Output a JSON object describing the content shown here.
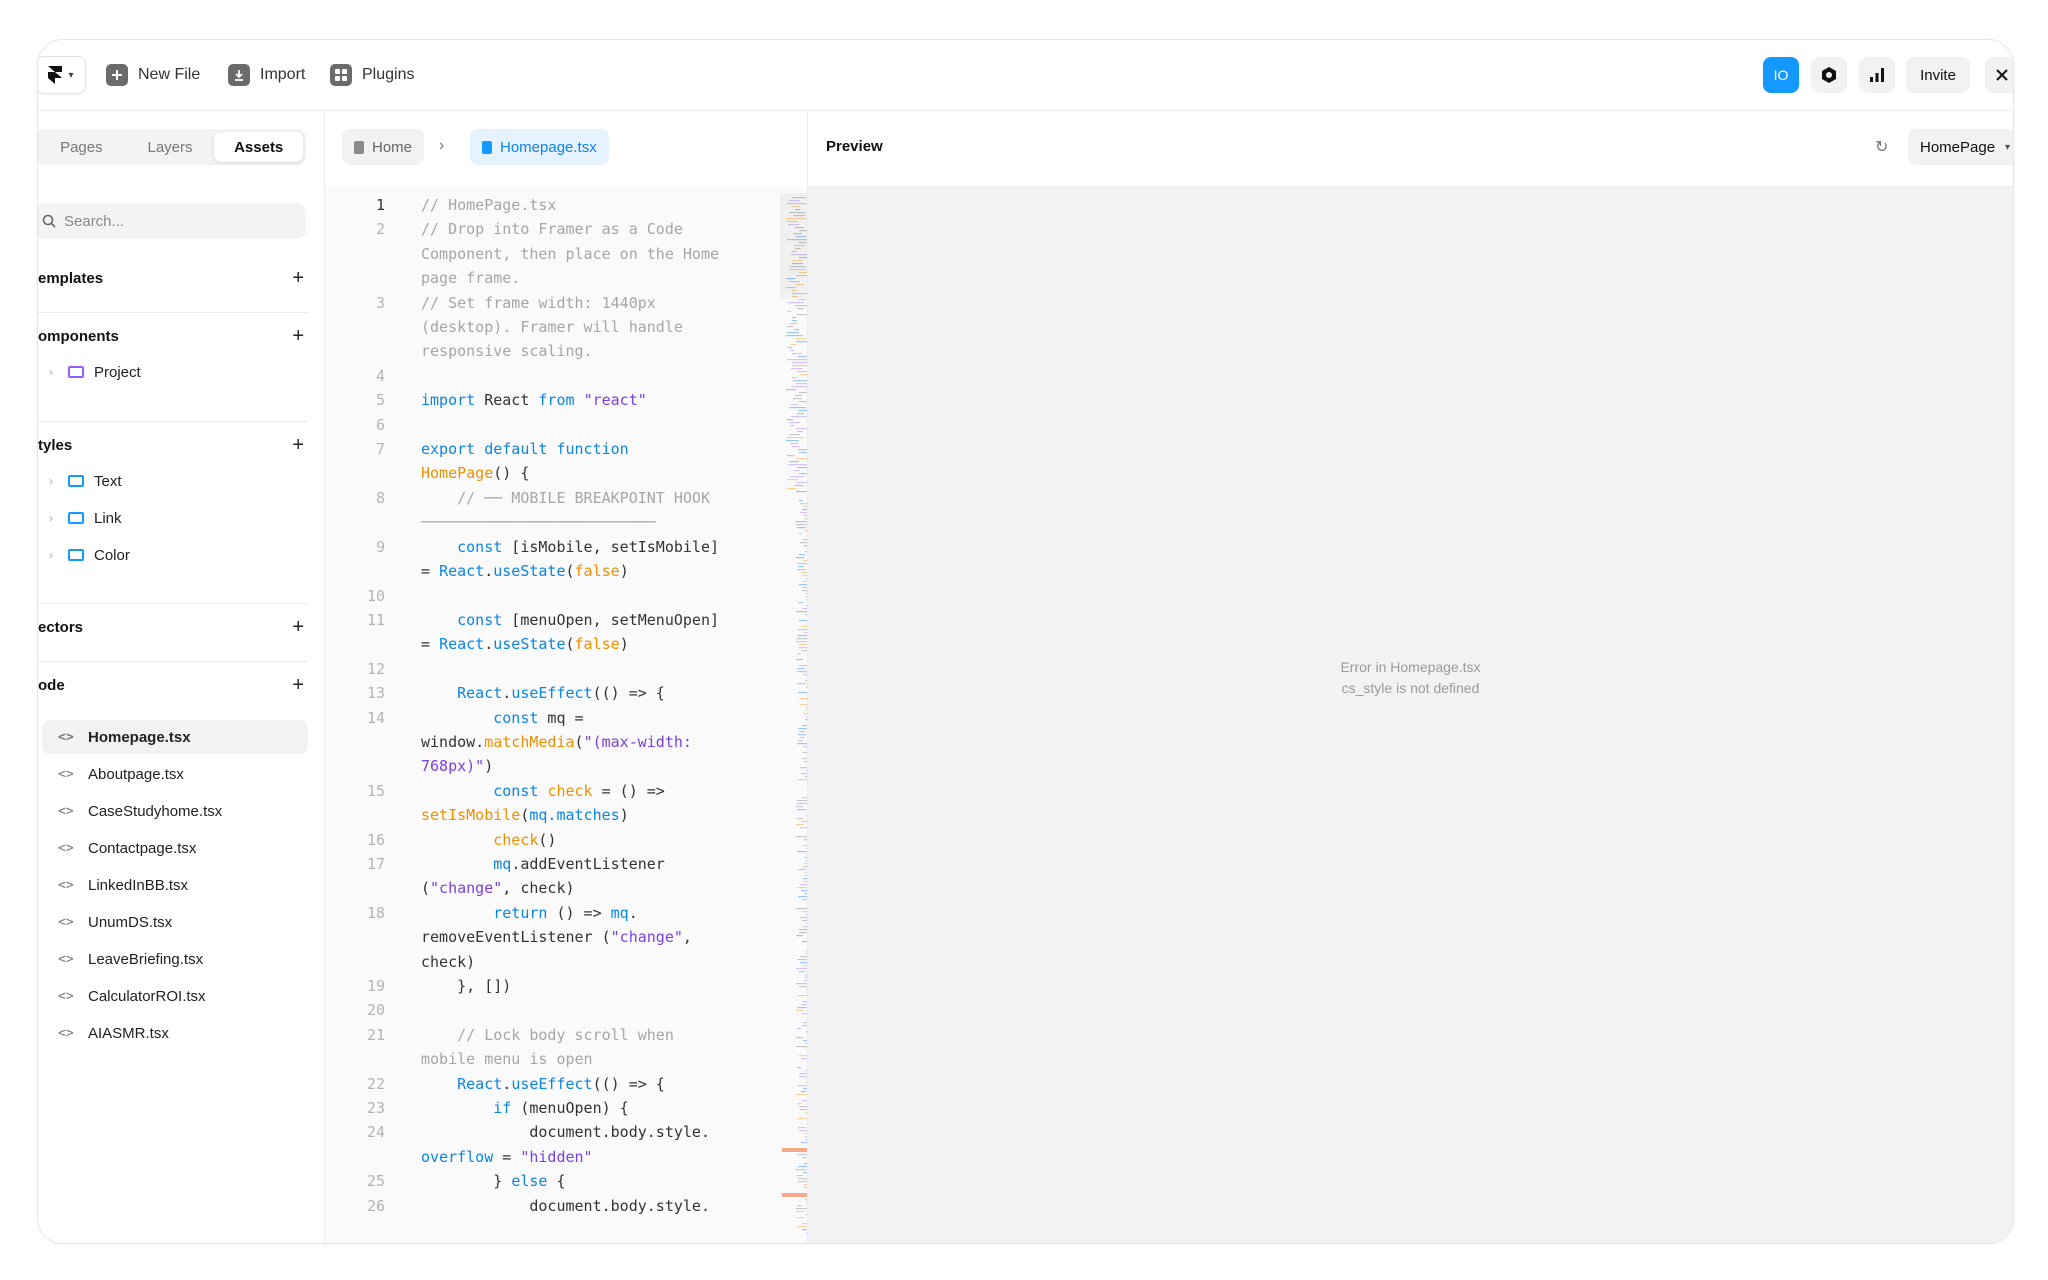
{
  "toolbar": {
    "new_file": "New File",
    "import": "Import",
    "plugins": "Plugins",
    "io_badge": "IO",
    "invite": "Invite"
  },
  "sidebar": {
    "tabs": [
      "Pages",
      "Layers",
      "Assets"
    ],
    "active_tab": "Assets",
    "search_placeholder": "Search...",
    "sections": {
      "templates": "emplates",
      "components": "omponents",
      "styles": "tyles",
      "vectors": "ectors",
      "code": "ode"
    },
    "component_items": [
      "Project"
    ],
    "style_items": [
      "Text",
      "Link",
      "Color"
    ],
    "code_files": [
      "Homepage.tsx",
      "Aboutpage.tsx",
      "CaseStudyhome.tsx",
      "Contactpage.tsx",
      "LinkedInBB.tsx",
      "UnumDS.tsx",
      "LeaveBriefing.tsx",
      "CalculatorROI.tsx",
      "AIASMR.tsx"
    ],
    "selected_file": "Homepage.tsx"
  },
  "editor": {
    "breadcrumb_home": "Home",
    "breadcrumb_file": "Homepage.tsx",
    "lines": [
      {
        "n": "1",
        "parts": [
          [
            "// HomePage.tsx",
            "com"
          ]
        ]
      },
      {
        "n": "2",
        "parts": [
          [
            "// Drop into Framer as a Code Component, then place on the Home page frame.",
            "com"
          ]
        ]
      },
      {
        "n": "3",
        "parts": [
          [
            "// Set frame width: 1440px (desktop). Framer will handle responsive scaling.",
            "com"
          ]
        ]
      },
      {
        "n": "4",
        "parts": [
          [
            "",
            ""
          ]
        ]
      },
      {
        "n": "5",
        "parts": [
          [
            "import",
            "kw"
          ],
          [
            " React ",
            ""
          ],
          [
            "from",
            "kw"
          ],
          [
            " ",
            ""
          ],
          [
            "\"react\"",
            "str"
          ]
        ]
      },
      {
        "n": "6",
        "parts": [
          [
            "",
            ""
          ]
        ]
      },
      {
        "n": "7",
        "parts": [
          [
            "export default function",
            "kw"
          ],
          [
            " ",
            ""
          ],
          [
            "HomePage",
            "fn"
          ],
          [
            "() {",
            ""
          ]
        ]
      },
      {
        "n": "8",
        "parts": [
          [
            "    // ── MOBILE BREAKPOINT HOOK ──────────────────────────",
            "com"
          ]
        ]
      },
      {
        "n": "9",
        "parts": [
          [
            "    ",
            ""
          ],
          [
            "const",
            "kw"
          ],
          [
            " [isMobile, setIsMobile] = ",
            ""
          ],
          [
            "React",
            "kw"
          ],
          [
            ".",
            ""
          ],
          [
            "useState",
            "kw"
          ],
          [
            "(",
            ""
          ],
          [
            "false",
            "fn"
          ],
          [
            ")",
            ""
          ]
        ]
      },
      {
        "n": "10",
        "parts": [
          [
            "",
            ""
          ]
        ]
      },
      {
        "n": "11",
        "parts": [
          [
            "    ",
            ""
          ],
          [
            "const",
            "kw"
          ],
          [
            " [menuOpen, setMenuOpen] = ",
            ""
          ],
          [
            "React",
            "kw"
          ],
          [
            ".",
            ""
          ],
          [
            "useState",
            "kw"
          ],
          [
            "(",
            ""
          ],
          [
            "false",
            "fn"
          ],
          [
            ")",
            ""
          ]
        ]
      },
      {
        "n": "12",
        "parts": [
          [
            "",
            ""
          ]
        ]
      },
      {
        "n": "13",
        "parts": [
          [
            "    ",
            ""
          ],
          [
            "React",
            "kw"
          ],
          [
            ".",
            ""
          ],
          [
            "useEffect",
            "kw"
          ],
          [
            "(() => {",
            ""
          ]
        ]
      },
      {
        "n": "14",
        "parts": [
          [
            "        ",
            ""
          ],
          [
            "const",
            "kw"
          ],
          [
            " mq = window.",
            ""
          ],
          [
            "matchMedia",
            "fn"
          ],
          [
            "(",
            ""
          ],
          [
            "\"(max-width: 768px)\"",
            "str"
          ],
          [
            ")",
            ""
          ]
        ]
      },
      {
        "n": "15",
        "parts": [
          [
            "        ",
            ""
          ],
          [
            "const",
            "kw"
          ],
          [
            " ",
            ""
          ],
          [
            "check",
            "fn"
          ],
          [
            " = () => ",
            ""
          ],
          [
            "setIsMobile",
            "fn"
          ],
          [
            "(",
            ""
          ],
          [
            "mq.matches",
            "kw"
          ],
          [
            ")",
            ""
          ]
        ]
      },
      {
        "n": "16",
        "parts": [
          [
            "        ",
            ""
          ],
          [
            "check",
            "fn"
          ],
          [
            "()",
            ""
          ]
        ]
      },
      {
        "n": "17",
        "parts": [
          [
            "        ",
            ""
          ],
          [
            "mq",
            "kw"
          ],
          [
            ".addEventListener (",
            ""
          ],
          [
            "\"change\"",
            "str"
          ],
          [
            ", check)",
            ""
          ]
        ]
      },
      {
        "n": "18",
        "parts": [
          [
            "        ",
            ""
          ],
          [
            "return",
            "kw"
          ],
          [
            " () => ",
            ""
          ],
          [
            "mq",
            "kw"
          ],
          [
            ". removeEventListener (",
            ""
          ],
          [
            "\"change\"",
            "str"
          ],
          [
            ", check)",
            ""
          ]
        ]
      },
      {
        "n": "19",
        "parts": [
          [
            "    }, [])",
            ""
          ]
        ]
      },
      {
        "n": "20",
        "parts": [
          [
            "",
            ""
          ]
        ]
      },
      {
        "n": "21",
        "parts": [
          [
            "    // Lock body scroll when mobile menu is open",
            "com"
          ]
        ]
      },
      {
        "n": "22",
        "parts": [
          [
            "    ",
            ""
          ],
          [
            "React",
            "kw"
          ],
          [
            ".",
            ""
          ],
          [
            "useEffect",
            "kw"
          ],
          [
            "(() => {",
            ""
          ]
        ]
      },
      {
        "n": "23",
        "parts": [
          [
            "        ",
            ""
          ],
          [
            "if",
            "kw"
          ],
          [
            " (menuOpen) {",
            ""
          ]
        ]
      },
      {
        "n": "24",
        "parts": [
          [
            "            document.body.style. ",
            ""
          ],
          [
            "overflow",
            "kw"
          ],
          [
            " = ",
            ""
          ],
          [
            "\"hidden\"",
            "str"
          ]
        ]
      },
      {
        "n": "25",
        "parts": [
          [
            "        } ",
            ""
          ],
          [
            "else",
            "kw"
          ],
          [
            " {",
            ""
          ]
        ]
      },
      {
        "n": "26",
        "parts": [
          [
            "            document.body.style.",
            ""
          ]
        ]
      }
    ]
  },
  "preview": {
    "title": "Preview",
    "page_select": "HomePage",
    "error_line1": "Error in Homepage.tsx",
    "error_line2": "cs_style is not defined"
  },
  "colors": {
    "accent": "#1399ff",
    "keyword": "#0a85e6",
    "string": "#7b3fe4",
    "function": "#ef8f00",
    "comment": "#a6a6a6"
  }
}
